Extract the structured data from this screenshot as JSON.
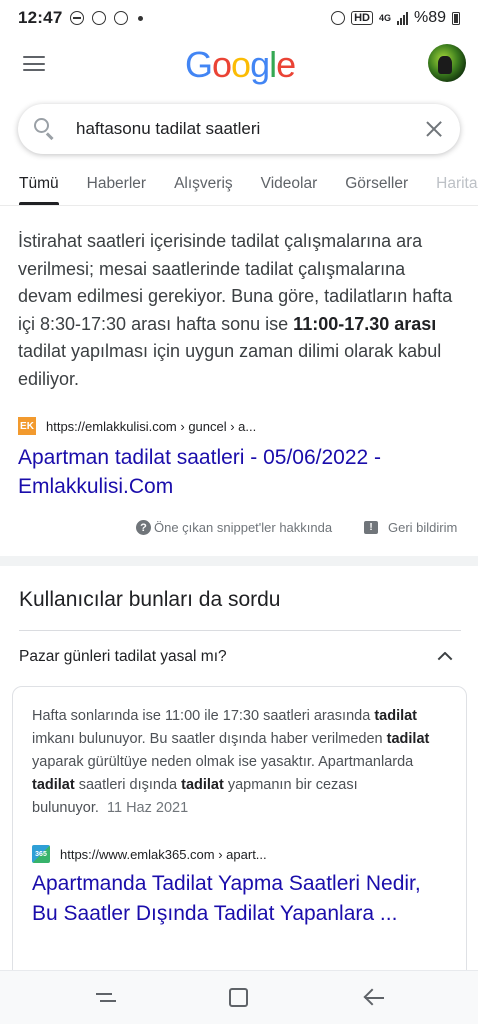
{
  "status_bar": {
    "time": "12:47",
    "battery": "%89",
    "network": "4G",
    "icons": [
      "do-not-disturb-icon",
      "sync-icon",
      "sync-icon",
      "notification-dot",
      "alarm-icon",
      "hd-voice-icon",
      "wifi-calling-icon",
      "signal-icon",
      "battery-icon"
    ]
  },
  "header": {
    "logo_letters": [
      "G",
      "o",
      "o",
      "g",
      "l",
      "e"
    ],
    "logo_colors": [
      "#4285F4",
      "#EA4335",
      "#FBBC05",
      "#4285F4",
      "#34A853",
      "#EA4335"
    ]
  },
  "search": {
    "query": "haftasonu tadilat saatleri"
  },
  "tabs": [
    {
      "label": "Tümü",
      "active": true
    },
    {
      "label": "Haberler",
      "active": false
    },
    {
      "label": "Alışveriş",
      "active": false
    },
    {
      "label": "Videolar",
      "active": false
    },
    {
      "label": "Görseller",
      "active": false
    },
    {
      "label": "Haritalar",
      "active": false
    }
  ],
  "featured_snippet": {
    "text_before": "İstirahat saatleri içerisinde tadilat çalışmalarına ara verilmesi; mesai saatlerinde tadilat çalışmalarına devam edilmesi gerekiyor. Buna göre, tadilatların hafta içi 8:30-17:30 arası hafta sonu ise ",
    "text_bold": "11:00-17.30 arası",
    "text_after": " tadilat yapılması için uygun zaman dilimi olarak kabul ediliyor.",
    "favicon_text": "EK",
    "source_url": "https://emlakkulisi.com › guncel › a...",
    "title": "Apartman tadilat saatleri - 05/06/2022 - Emlakkulisi.Com",
    "about_label": "Öne çıkan snippet'ler hakkında",
    "feedback_label": "Geri bildirim"
  },
  "people_also_ask": {
    "title": "Kullanıcılar bunları da sordu",
    "question": "Pazar günleri tadilat yasal mı?",
    "answer": {
      "p1": "Hafta sonlarında ise 11:00 ile 17:30 saatleri arasında ",
      "b1": "tadilat",
      "p2": " imkanı bulunuyor. Bu saatler dışında haber verilmeden ",
      "b2": "tadilat",
      "p3": " yaparak gürültüye neden olmak ise yasaktır. Apartmanlarda ",
      "b3": "tadilat",
      "p4": " saatleri dışında ",
      "b4": "tadilat",
      "p5": " yapmanın bir cezası bulunuyor.",
      "date": "11 Haz 2021"
    },
    "favicon_text": "365",
    "source_url": "https://www.emlak365.com › apart...",
    "link_title": "Apartmanda Tadilat Yapma Saatleri Nedir, Bu Saatler Dışında Tadilat Yapanlara ..."
  }
}
